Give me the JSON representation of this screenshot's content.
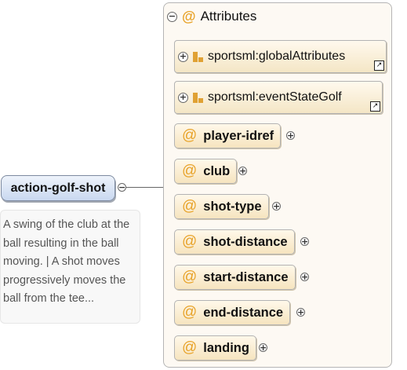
{
  "root": {
    "label": "action-golf-shot",
    "documentation": "A swing of the club at the ball resulting in the ball moving. | A shot moves progressively moves the ball from the tee..."
  },
  "panel": {
    "title": "Attributes",
    "at_symbol": "@",
    "groups": [
      {
        "label": "sportsml:globalAttributes"
      },
      {
        "label": "sportsml:eventStateGolf"
      }
    ],
    "attributes": [
      {
        "label": "player-idref"
      },
      {
        "label": "club"
      },
      {
        "label": "shot-type"
      },
      {
        "label": "shot-distance"
      },
      {
        "label": "start-distance"
      },
      {
        "label": "end-distance"
      },
      {
        "label": "landing"
      }
    ]
  },
  "icons": {
    "expand": "+",
    "collapse": "−",
    "link": "↗"
  }
}
